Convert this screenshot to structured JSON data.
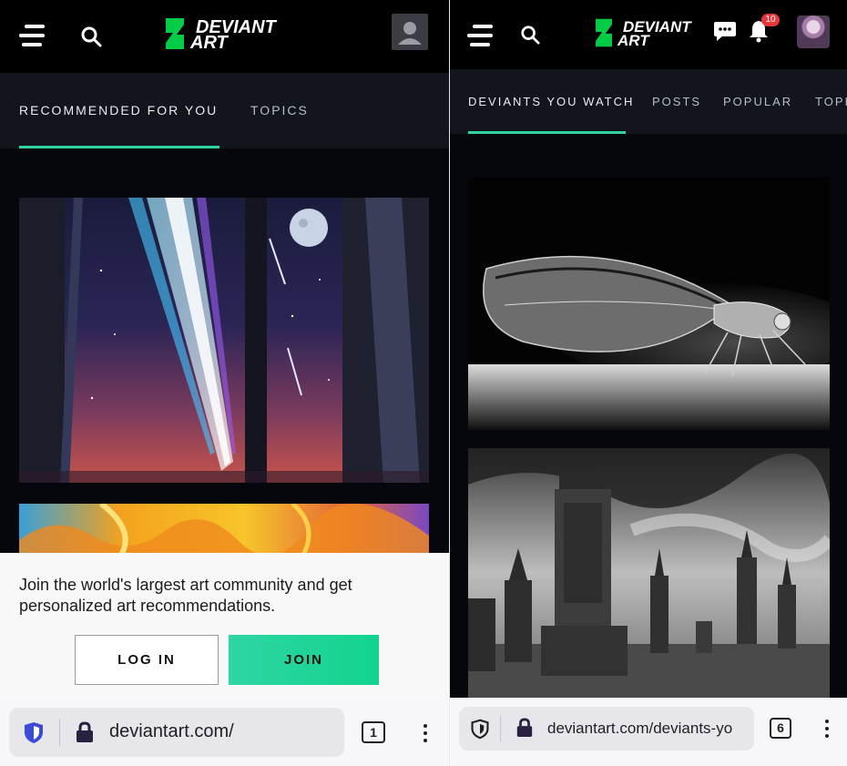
{
  "left": {
    "site_logo": {
      "line1": "DEVIANT",
      "line2": "ART"
    },
    "tabs": [
      {
        "label": "RECOMMENDED FOR YOU",
        "active": true
      },
      {
        "label": "TOPICS",
        "active": false
      }
    ],
    "signup_overlay": {
      "message": "Join the world's largest art community and get personalized art recommendations.",
      "login_label": "LOG IN",
      "join_label": "JOIN"
    },
    "browser": {
      "url": "deviantart.com/",
      "tab_count": "1"
    }
  },
  "right": {
    "site_logo": {
      "line1": "DEVIANT",
      "line2": "ART"
    },
    "notification_count": "10",
    "tabs": [
      {
        "label": "DEVIANTS YOU WATCH",
        "active": true
      },
      {
        "label": "POSTS",
        "active": false
      },
      {
        "label": "POPULAR",
        "active": false
      },
      {
        "label": "TOPI",
        "active": false
      }
    ],
    "browser": {
      "url": "deviantart.com/deviants-yo",
      "tab_count": "6"
    }
  },
  "colors": {
    "brand_green": "#05cc47",
    "accent_teal": "#2fd5a2",
    "badge_red": "#e8383a",
    "background": "#06070d",
    "tabbar": "#13151c"
  },
  "icons": [
    "menu-icon",
    "search-icon",
    "deviantart-logo-icon",
    "user-icon",
    "chat-icon",
    "bell-icon",
    "shield-icon",
    "lock-icon",
    "tabs-icon",
    "more-icon"
  ]
}
